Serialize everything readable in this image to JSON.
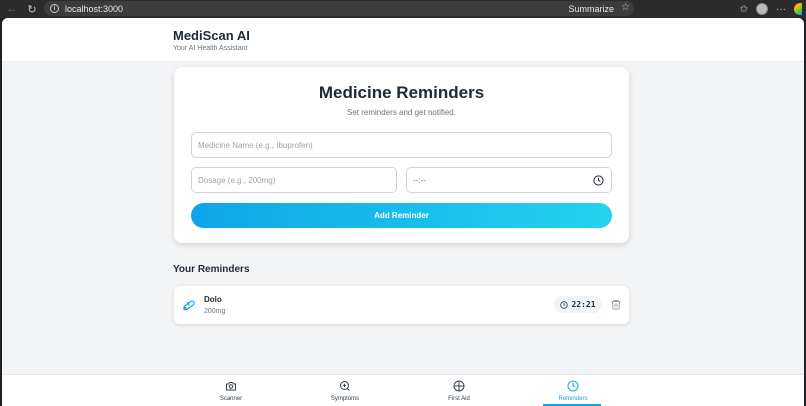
{
  "browser": {
    "url": "localhost:3000",
    "summarize_label": "Summarize"
  },
  "header": {
    "title": "MediScan AI",
    "subtitle": "Your AI Health Assistant"
  },
  "form": {
    "title": "Medicine Reminders",
    "subtitle": "Set reminders and get notified.",
    "name_placeholder": "Medicine Name (e.g., Ibuprofen)",
    "dosage_placeholder": "Dosage (e.g., 200mg)",
    "time_value": "--:--",
    "add_button": "Add Reminder"
  },
  "reminders": {
    "section_title": "Your Reminders",
    "items": [
      {
        "name": "Dolo",
        "dosage": "200mg",
        "time": "22:21"
      }
    ]
  },
  "nav": {
    "items": [
      {
        "label": "Scanner",
        "icon": "camera-icon"
      },
      {
        "label": "Symptoms",
        "icon": "symptom-search-icon"
      },
      {
        "label": "First Aid",
        "icon": "plus-circle-icon"
      },
      {
        "label": "Reminders",
        "icon": "clock-icon"
      }
    ],
    "active": "Reminders"
  },
  "colors": {
    "accent": "#0ea5e9",
    "accent_end": "#22d3ee",
    "text": "#1f2937",
    "muted": "#6b7280"
  }
}
